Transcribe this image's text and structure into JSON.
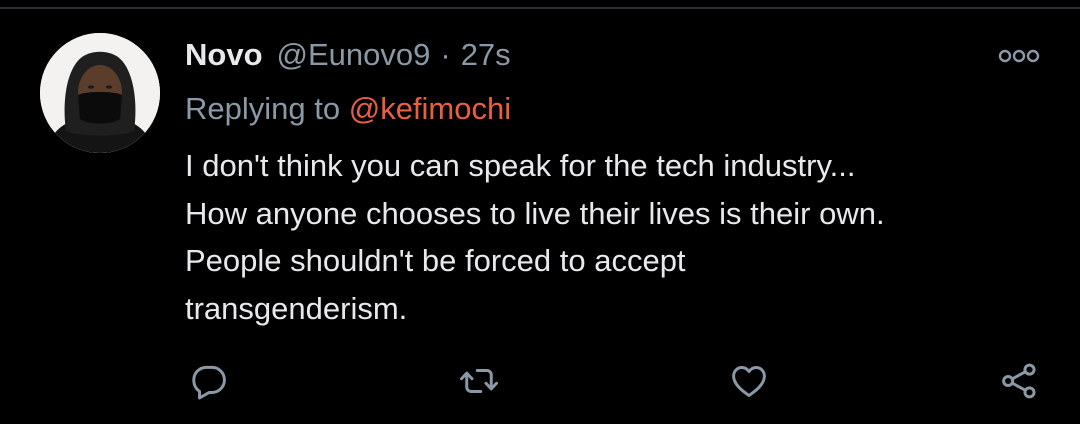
{
  "tweet": {
    "display_name": "Novo",
    "handle": "@Eunovo9",
    "separator": "·",
    "timestamp": "27s",
    "replying_prefix": "Replying to ",
    "replying_to": "@kefimochi",
    "text": "I don't think you can speak for the tech industry...\nHow anyone chooses to live their lives is their own.\nPeople shouldn't be forced to accept\ntransgenderism."
  },
  "icons": {
    "more": "more-options-icon",
    "reply": "reply-icon",
    "retweet": "retweet-icon",
    "like": "like-icon",
    "share": "share-icon"
  },
  "colors": {
    "background": "#000000",
    "primary_text": "#e7e9ea",
    "secondary_text": "#8b98a5",
    "mention": "#e9603f",
    "divider": "#2f3336"
  }
}
